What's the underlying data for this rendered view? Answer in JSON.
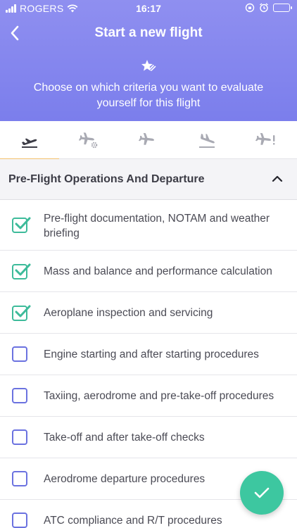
{
  "status_bar": {
    "carrier": "ROGERS",
    "time": "16:17"
  },
  "header": {
    "title": "Start a new flight",
    "subtitle": "Choose on which criteria you want to evaluate yourself for this flight",
    "icon": "sparkle-star-icon"
  },
  "tabs": [
    {
      "icon": "departure-icon",
      "active": true
    },
    {
      "icon": "plane-settings-icon",
      "active": false
    },
    {
      "icon": "plane-icon",
      "active": false
    },
    {
      "icon": "landing-icon",
      "active": false
    },
    {
      "icon": "plane-alert-icon",
      "active": false
    }
  ],
  "section": {
    "title": "Pre-Flight Operations And Departure",
    "expanded": true
  },
  "items": [
    {
      "label": "Pre-flight documentation, NOTAM and weather briefing",
      "checked": true
    },
    {
      "label": "Mass and balance and performance calculation",
      "checked": true
    },
    {
      "label": "Aeroplane inspection and servicing",
      "checked": true
    },
    {
      "label": "Engine starting and after starting procedures",
      "checked": false
    },
    {
      "label": "Taxiing, aerodrome and pre-take-off procedures",
      "checked": false
    },
    {
      "label": "Take-off and after take-off checks",
      "checked": false
    },
    {
      "label": "Aerodrome departure procedures",
      "checked": false
    },
    {
      "label": "ATC compliance and R/T procedures",
      "checked": false
    }
  ],
  "colors": {
    "header_top": "#8f8ff0",
    "header_bottom": "#7b7eec",
    "accent_underline": "#f3c16b",
    "check_green": "#3dbb9a",
    "checkbox_border": "#6b72e0",
    "fab": "#3dc7a0"
  }
}
